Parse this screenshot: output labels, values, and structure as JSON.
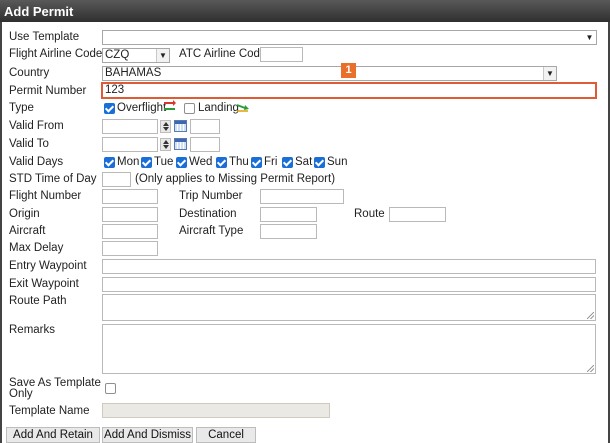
{
  "dialog": {
    "title": "Add Permit"
  },
  "form": {
    "use_template": {
      "label": "Use Template",
      "value": ""
    },
    "flight_airline_code": {
      "label": "Flight Airline Code",
      "value": "CZQ"
    },
    "atc_airline_code": {
      "label": "ATC Airline Code",
      "value": ""
    },
    "country": {
      "label": "Country",
      "value": "BAHAMAS"
    },
    "permit_number": {
      "label": "Permit Number",
      "value": "123"
    },
    "type": {
      "label": "Type",
      "options": [
        {
          "label": "Overflight",
          "checked": true,
          "icon": "overflight-arrow-icon"
        },
        {
          "label": "Landing",
          "checked": false,
          "icon": "landing-arrow-icon"
        }
      ]
    },
    "valid_from": {
      "label": "Valid From"
    },
    "valid_to": {
      "label": "Valid To"
    },
    "valid_days": {
      "label": "Valid Days",
      "days": [
        {
          "label": "Mon",
          "checked": true
        },
        {
          "label": "Tue",
          "checked": true
        },
        {
          "label": "Wed",
          "checked": true
        },
        {
          "label": "Thu",
          "checked": true
        },
        {
          "label": "Fri",
          "checked": true
        },
        {
          "label": "Sat",
          "checked": true
        },
        {
          "label": "Sun",
          "checked": true
        }
      ]
    },
    "std_time_of_day": {
      "label": "STD Time of Day",
      "note": "(Only applies to Missing Permit Report)"
    },
    "flight_number": {
      "label": "Flight Number"
    },
    "trip_number": {
      "label": "Trip Number"
    },
    "origin": {
      "label": "Origin"
    },
    "destination": {
      "label": "Destination"
    },
    "route": {
      "label": "Route"
    },
    "aircraft": {
      "label": "Aircraft"
    },
    "aircraft_type": {
      "label": "Aircraft Type"
    },
    "max_delay": {
      "label": "Max Delay"
    },
    "entry_waypoint": {
      "label": "Entry Waypoint"
    },
    "exit_waypoint": {
      "label": "Exit Waypoint"
    },
    "route_path": {
      "label": "Route Path"
    },
    "remarks": {
      "label": "Remarks"
    },
    "save_as_template": {
      "label_line1": "Save As Template",
      "label_line2": "Only",
      "checked": false
    },
    "template_name": {
      "label": "Template Name"
    }
  },
  "annotation": {
    "badge": "1",
    "color": "#e8702a"
  },
  "buttons": {
    "add_and_retain": "Add And Retain",
    "add_and_dismiss": "Add And Dismiss",
    "cancel": "Cancel"
  },
  "colors": {
    "titlebar": "#3a3a3a",
    "checkbox": "#1a6fd6",
    "highlight_border": "#e05a36"
  }
}
